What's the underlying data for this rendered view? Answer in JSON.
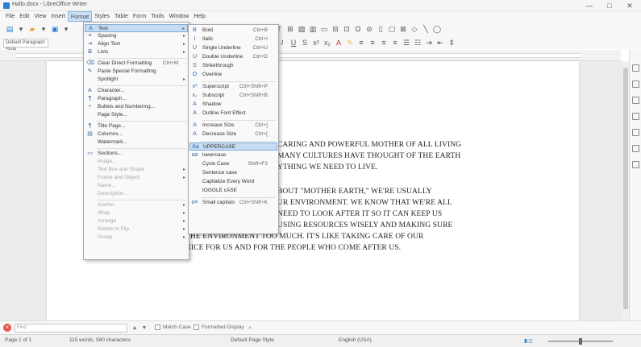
{
  "window": {
    "title": "Hallo.docx - LibreOffice Writer",
    "controls": [
      "—",
      "□",
      "✕"
    ]
  },
  "menubar": [
    "File",
    "Edit",
    "View",
    "Insert",
    "Format",
    "Styles",
    "Table",
    "Form",
    "Tools",
    "Window",
    "Help"
  ],
  "toolbar": {
    "paragraph_style": "Default Paragraph Style"
  },
  "format_menu": [
    {
      "icon": "A",
      "label": "Text",
      "shortcut": "",
      "submenu": true,
      "highlighted": true,
      "disabled": false
    },
    {
      "icon": "≡",
      "label": "Spacing",
      "shortcut": "",
      "submenu": true,
      "disabled": false
    },
    {
      "icon": "⇥",
      "label": "Align Text",
      "shortcut": "",
      "submenu": true,
      "disabled": false
    },
    {
      "icon": "≣",
      "label": "Lists",
      "shortcut": "",
      "submenu": true,
      "disabled": false
    },
    {
      "sep": true
    },
    {
      "icon": "⌫",
      "label": "Clear Direct Formatting",
      "shortcut": "Ctrl+M",
      "disabled": false
    },
    {
      "icon": "✎",
      "label": "Paste Special Formatting",
      "shortcut": "",
      "disabled": false
    },
    {
      "icon": "",
      "label": "Spotlight",
      "shortcut": "",
      "submenu": true,
      "disabled": false
    },
    {
      "sep": true
    },
    {
      "icon": "A",
      "label": "Character...",
      "shortcut": "",
      "disabled": false
    },
    {
      "icon": "¶",
      "label": "Paragraph...",
      "shortcut": "",
      "disabled": false
    },
    {
      "icon": "•",
      "label": "Bullets and Numbering...",
      "shortcut": "",
      "disabled": false
    },
    {
      "icon": "",
      "label": "Page Style...",
      "shortcut": "",
      "disabled": false
    },
    {
      "sep": true
    },
    {
      "icon": "¶",
      "label": "Title Page...",
      "shortcut": "",
      "disabled": false
    },
    {
      "icon": "▤",
      "label": "Columns...",
      "shortcut": "",
      "disabled": false
    },
    {
      "icon": "",
      "label": "Watermark...",
      "shortcut": "",
      "disabled": false
    },
    {
      "sep": true
    },
    {
      "icon": "▭",
      "label": "Sections...",
      "shortcut": "",
      "disabled": false
    },
    {
      "icon": "",
      "label": "Image...",
      "shortcut": "",
      "disabled": true
    },
    {
      "icon": "",
      "label": "Text Box and Shape",
      "shortcut": "",
      "submenu": true,
      "disabled": true
    },
    {
      "icon": "",
      "label": "Frame and Object",
      "shortcut": "",
      "submenu": true,
      "disabled": true
    },
    {
      "icon": "",
      "label": "Name...",
      "shortcut": "",
      "disabled": true
    },
    {
      "icon": "",
      "label": "Description...",
      "shortcut": "",
      "disabled": true
    },
    {
      "sep": true
    },
    {
      "icon": "",
      "label": "Anchor",
      "shortcut": "",
      "submenu": true,
      "disabled": true
    },
    {
      "icon": "",
      "label": "Wrap",
      "shortcut": "",
      "submenu": true,
      "disabled": true
    },
    {
      "icon": "",
      "label": "Arrange",
      "shortcut": "",
      "submenu": true,
      "disabled": true
    },
    {
      "icon": "",
      "label": "Rotate or Flip",
      "shortcut": "",
      "submenu": true,
      "disabled": true
    },
    {
      "icon": "",
      "label": "Group",
      "shortcut": "",
      "submenu": true,
      "disabled": true
    }
  ],
  "text_submenu": [
    {
      "icon": "B",
      "label": "Bold",
      "shortcut": "Ctrl+B"
    },
    {
      "icon": "I",
      "label": "Italic",
      "shortcut": "Ctrl+I"
    },
    {
      "icon": "U",
      "label": "Single Underline",
      "shortcut": "Ctrl+U"
    },
    {
      "icon": "U",
      "label": "Double Underline",
      "shortcut": "Ctrl+D"
    },
    {
      "icon": "S",
      "label": "Strikethrough",
      "shortcut": ""
    },
    {
      "icon": "O",
      "label": "Overline",
      "shortcut": ""
    },
    {
      "sep": true
    },
    {
      "icon": "x²",
      "label": "Superscript",
      "shortcut": "Ctrl+Shift+P"
    },
    {
      "icon": "x₂",
      "label": "Subscript",
      "shortcut": "Ctrl+Shift+B"
    },
    {
      "icon": "A",
      "label": "Shadow",
      "shortcut": ""
    },
    {
      "icon": "A",
      "label": "Outline Font Effect",
      "shortcut": ""
    },
    {
      "sep": true
    },
    {
      "icon": "A",
      "label": "Increase Size",
      "shortcut": "Ctrl+]"
    },
    {
      "icon": "A",
      "label": "Decrease Size",
      "shortcut": "Ctrl+["
    },
    {
      "sep": true
    },
    {
      "icon": "Aa",
      "label": "UPPERCASE",
      "shortcut": "",
      "highlighted": true
    },
    {
      "icon": "aa",
      "label": "lowercase",
      "shortcut": ""
    },
    {
      "icon": "",
      "label": "Cycle Case",
      "shortcut": "Shift+F3"
    },
    {
      "icon": "",
      "label": "Sentence case",
      "shortcut": ""
    },
    {
      "icon": "",
      "label": "Capitalize Every Word",
      "shortcut": ""
    },
    {
      "icon": "",
      "label": "tOGGLE cASE",
      "shortcut": ""
    },
    {
      "sep": true
    },
    {
      "icon": "a≡",
      "label": "Small capitals",
      "shortcut": "Ctrl+Shift+K"
    }
  ],
  "document": {
    "fragments": [
      "CARING AND POWERFUL MOTHER OF ALL LIVING",
      "MANY CULTURES HAVE THOUGHT OF THE EARTH",
      "YTHING WE NEED TO LIVE.",
      "BOUT \"MOTHER EARTH,\" WE'RE USUALLY",
      "UR ENVIRONMENT. WE KNOW THAT WE'RE ALL",
      "NEED TO LOOK AFTER IT SO IT CAN KEEP US",
      "USING RESOURCES WISELY AND MAKING SURE",
      "THE ENVIRONMENT TOO MUCH. IT'S LIKE TAKING CARE OF OUR",
      "NICE FOR US AND FOR THE PEOPLE WHO COME AFTER US."
    ]
  },
  "findbar": {
    "placeholder": "Find",
    "match_case": "Match Case",
    "formatted_display": "Formatted Display"
  },
  "statusbar": {
    "page": "Page 1 of 1",
    "words": "115 words, 580 characters",
    "page_style": "Default Page Style",
    "language": "English (USA)"
  }
}
